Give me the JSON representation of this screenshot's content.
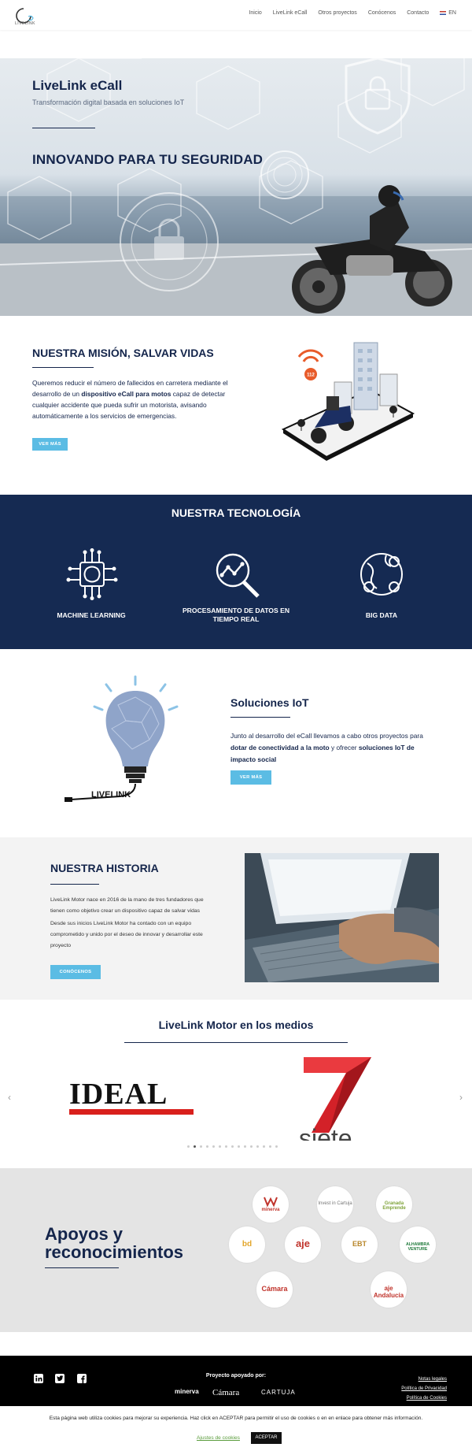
{
  "header": {
    "logo_text": "LIVELINK",
    "nav": [
      "Inicio",
      "LiveLink eCall",
      "Otros proyectos",
      "Conócenos",
      "Contacto"
    ],
    "lang": "EN"
  },
  "hero": {
    "title": "LiveLink eCall",
    "subtitle": "Transformación digital basada en soluciones IoT",
    "heading": "INNOVANDO PARA TU SEGURIDAD"
  },
  "mission": {
    "title": "NUESTRA MISIÓN, SALVAR VIDAS",
    "text_1": "Queremos reducir el número de fallecidos en carretera mediante el desarrollo de un ",
    "text_bold": "dispositivo eCall para motos",
    "text_2": " capaz de detectar cualquier accidente que pueda sufrir un motorista, avisando automáticamente a los servicios de emergencias.",
    "button": "VER MÁS",
    "badge": "112"
  },
  "tech": {
    "title": "NUESTRA TECNOLOGÍA",
    "items": [
      "MACHINE LEARNING",
      "PROCESAMIENTO DE DATOS EN TIEMPO REAL",
      "BIG DATA"
    ]
  },
  "iot": {
    "title": "Soluciones IoT",
    "text_1": "Junto al desarrollo del eCall llevamos a cabo otros proyectos para ",
    "text_bold_1": "dotar de conectividad a la moto",
    "text_2": " y ofrecer ",
    "text_bold_2": "soluciones IoT de impacto social",
    "button": "VER MÁS",
    "bulb_label": "LIVELINK"
  },
  "history": {
    "title": "NUESTRA HISTORIA",
    "p1": "LiveLink Motor nace en 2016 de la mano de tres fundadores que tienen como objetivo crear un dispositivo capaz de salvar vidas",
    "p2": "Desde sus inicios LiveLink Motor ha contado con un equipo comprometido y unido por el deseo de innovar y desarrollar este proyecto",
    "button": "CONÓCENOS"
  },
  "media": {
    "title": "LiveLink Motor en los medios",
    "logos": [
      "IDEAL",
      "siete"
    ],
    "prev": "‹",
    "next": "›",
    "dots_total": 15,
    "dots_active": 2
  },
  "support": {
    "title_1": "Apoyos y",
    "title_2": "reconocimientos",
    "logos": [
      "minerva",
      "Invest in Cartuja",
      "Granada Emprende",
      "bd",
      "aje",
      "EBT",
      "ALHAMBRA VENTURE",
      "Cámara",
      "aje Andalucía"
    ]
  },
  "footer": {
    "sponsor": "Proyecto apoyado por:",
    "links": [
      "Notas legales",
      "Política de Privacidad",
      "Política de Cookies"
    ],
    "sponsor_logos": [
      "minerva",
      "Cámara",
      "CARTUJA"
    ]
  },
  "cookie": {
    "text": "Esta página web utiliza cookies para mejorar su experiencia. Haz click en ACEPTAR para permitir el uso de cookies o en en enlace para obtener más información.",
    "settings": "Ajustes de cookies",
    "accept": "ACEPTAR"
  },
  "colors": {
    "navy": "#152a52",
    "accent": "#5bbce4",
    "ideal_red": "#d9201c"
  }
}
